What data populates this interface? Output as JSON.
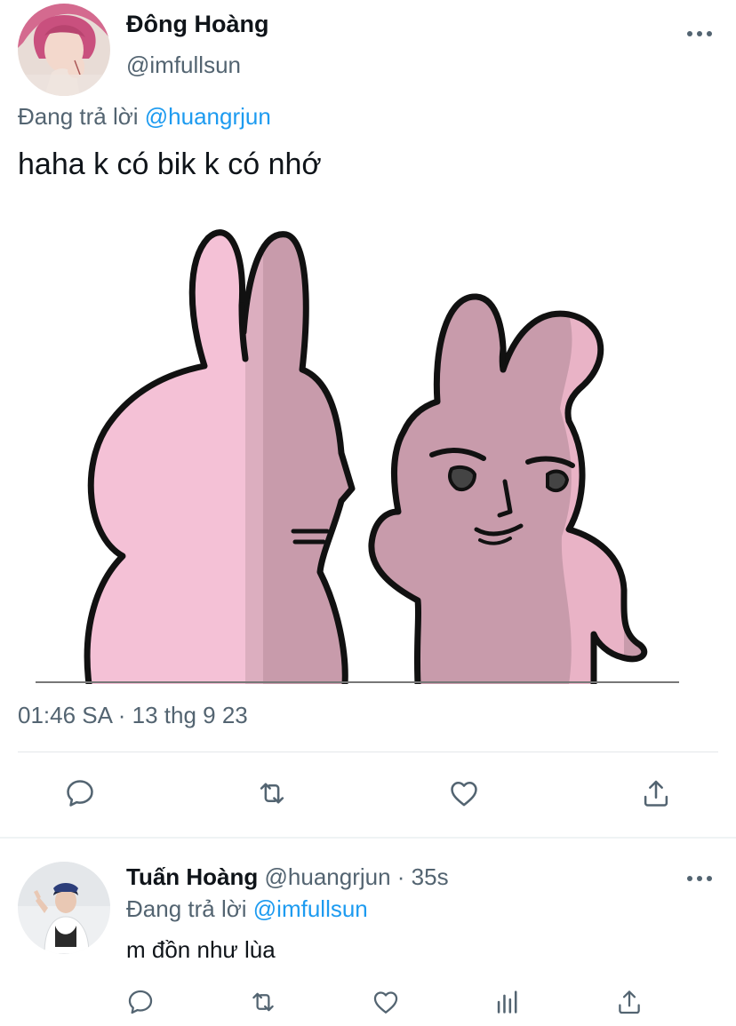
{
  "main_tweet": {
    "author_name": "Đông Hoàng",
    "handle": "@imfullsun",
    "replying_prefix": "Đang trả lời ",
    "replying_to": "@huangrjun",
    "text": "haha k có bik k có nhớ",
    "timestamp": "01:46 SA · 13 thg 9 23",
    "actions": [
      "reply-icon",
      "retweet-icon",
      "like-icon",
      "share-icon"
    ]
  },
  "reply_tweet": {
    "author_name": "Tuấn Hoàng",
    "meta": " @huangrjun · 35s",
    "replying_prefix": "Đang trả lời ",
    "replying_to": "@imfullsun",
    "text": "m đồn như lùa",
    "actions": [
      "reply-icon",
      "retweet-icon",
      "like-icon",
      "views-icon",
      "share-icon"
    ]
  },
  "colors": {
    "link": "#1d9bf0",
    "secondary_text": "#536471",
    "icon": "#536471",
    "bunny_pink": "#f4c1d6",
    "bunny_shade": "#c89bab"
  }
}
